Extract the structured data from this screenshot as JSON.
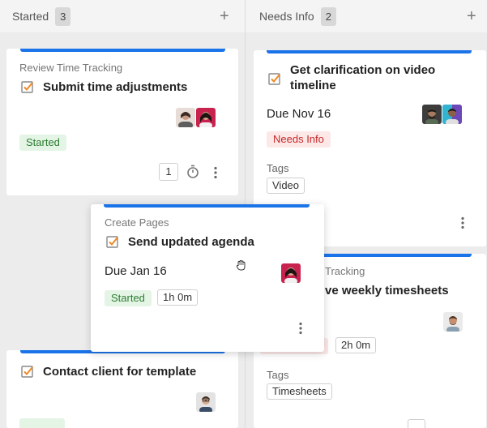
{
  "colors": {
    "accent": "#1a73e8",
    "started_bg": "#e4f5e6",
    "started_text": "#2e7d32",
    "needs_bg": "#fde8e8",
    "needs_text": "#c62828"
  },
  "columns": [
    {
      "title": "Started",
      "count": "3",
      "add_icon": "plus-icon"
    },
    {
      "title": "Needs Info",
      "count": "2",
      "add_icon": "plus-icon"
    }
  ],
  "cards": {
    "review": {
      "subtitle": "Review Time Tracking",
      "title": "Submit time adjustments",
      "status": "Started",
      "comment_count": "1"
    },
    "clarify": {
      "title_line1": "Get clarification on video",
      "title_line2": "timeline",
      "due": "Due Nov 16",
      "status": "Needs Info",
      "tags_label": "Tags",
      "tag": "Video"
    },
    "agenda": {
      "subtitle": "Create Pages",
      "title": "Send updated agenda",
      "due": "Due Jan 16",
      "status": "Started",
      "duration": "1h 0m"
    },
    "timesheets": {
      "subtitle_partial": "Tracking",
      "title_partial": "ve weekly timesheets",
      "duration": "2h 0m",
      "tags_label": "Tags",
      "tag": "Timesheets"
    },
    "contact": {
      "title": "Contact client for template"
    }
  }
}
